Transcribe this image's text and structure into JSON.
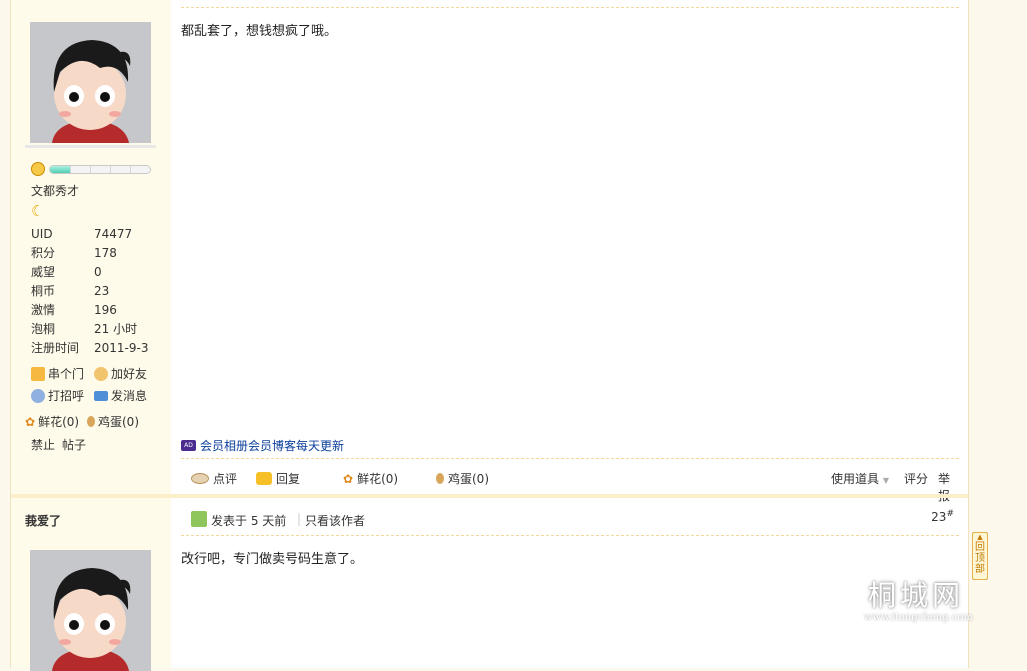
{
  "post1": {
    "user": {
      "rank_title": "文都秀才",
      "rank_progress": 0.2,
      "stats": [
        {
          "label": "UID",
          "value": "74477"
        },
        {
          "label": "积分",
          "value": "178"
        },
        {
          "label": "威望",
          "value": "0"
        },
        {
          "label": "桐币",
          "value": "23"
        },
        {
          "label": "激情",
          "value": "196"
        },
        {
          "label": "泡桐",
          "value": "21 小时"
        },
        {
          "label": "注册时间",
          "value": "2011-9-3"
        }
      ],
      "actions": {
        "visit": "串个门",
        "add_friend": "加好友",
        "greet": "打招呼",
        "message": "发消息",
        "flowers": "鲜花(0)",
        "eggs": "鸡蛋(0)",
        "ban": "禁止",
        "posts": "帖子"
      }
    },
    "message": "都乱套了，想钱想疯了哦。",
    "ad_badge": "AD",
    "ad_text": "会员相册会员博客每天更新",
    "actions": {
      "comment": "点评",
      "reply": "回复",
      "flowers": "鲜花(0)",
      "eggs": "鸡蛋(0)",
      "use_tool": "使用道具",
      "rate": "评分",
      "report": "举报"
    }
  },
  "post2": {
    "author": "莪爱了",
    "posted": "发表于 5 天前",
    "only_author": "只看该作者",
    "floor": "23",
    "floor_mark": "#",
    "message": "改行吧，专门做卖号码生意了。"
  },
  "back_top": "回顶部",
  "watermark": {
    "text": "桐城网",
    "url": "www.itongcheng.com"
  },
  "colors": {
    "sidebar_bg": "#fffbea",
    "link": "#0b3f9b",
    "border": "#f2d89a"
  }
}
